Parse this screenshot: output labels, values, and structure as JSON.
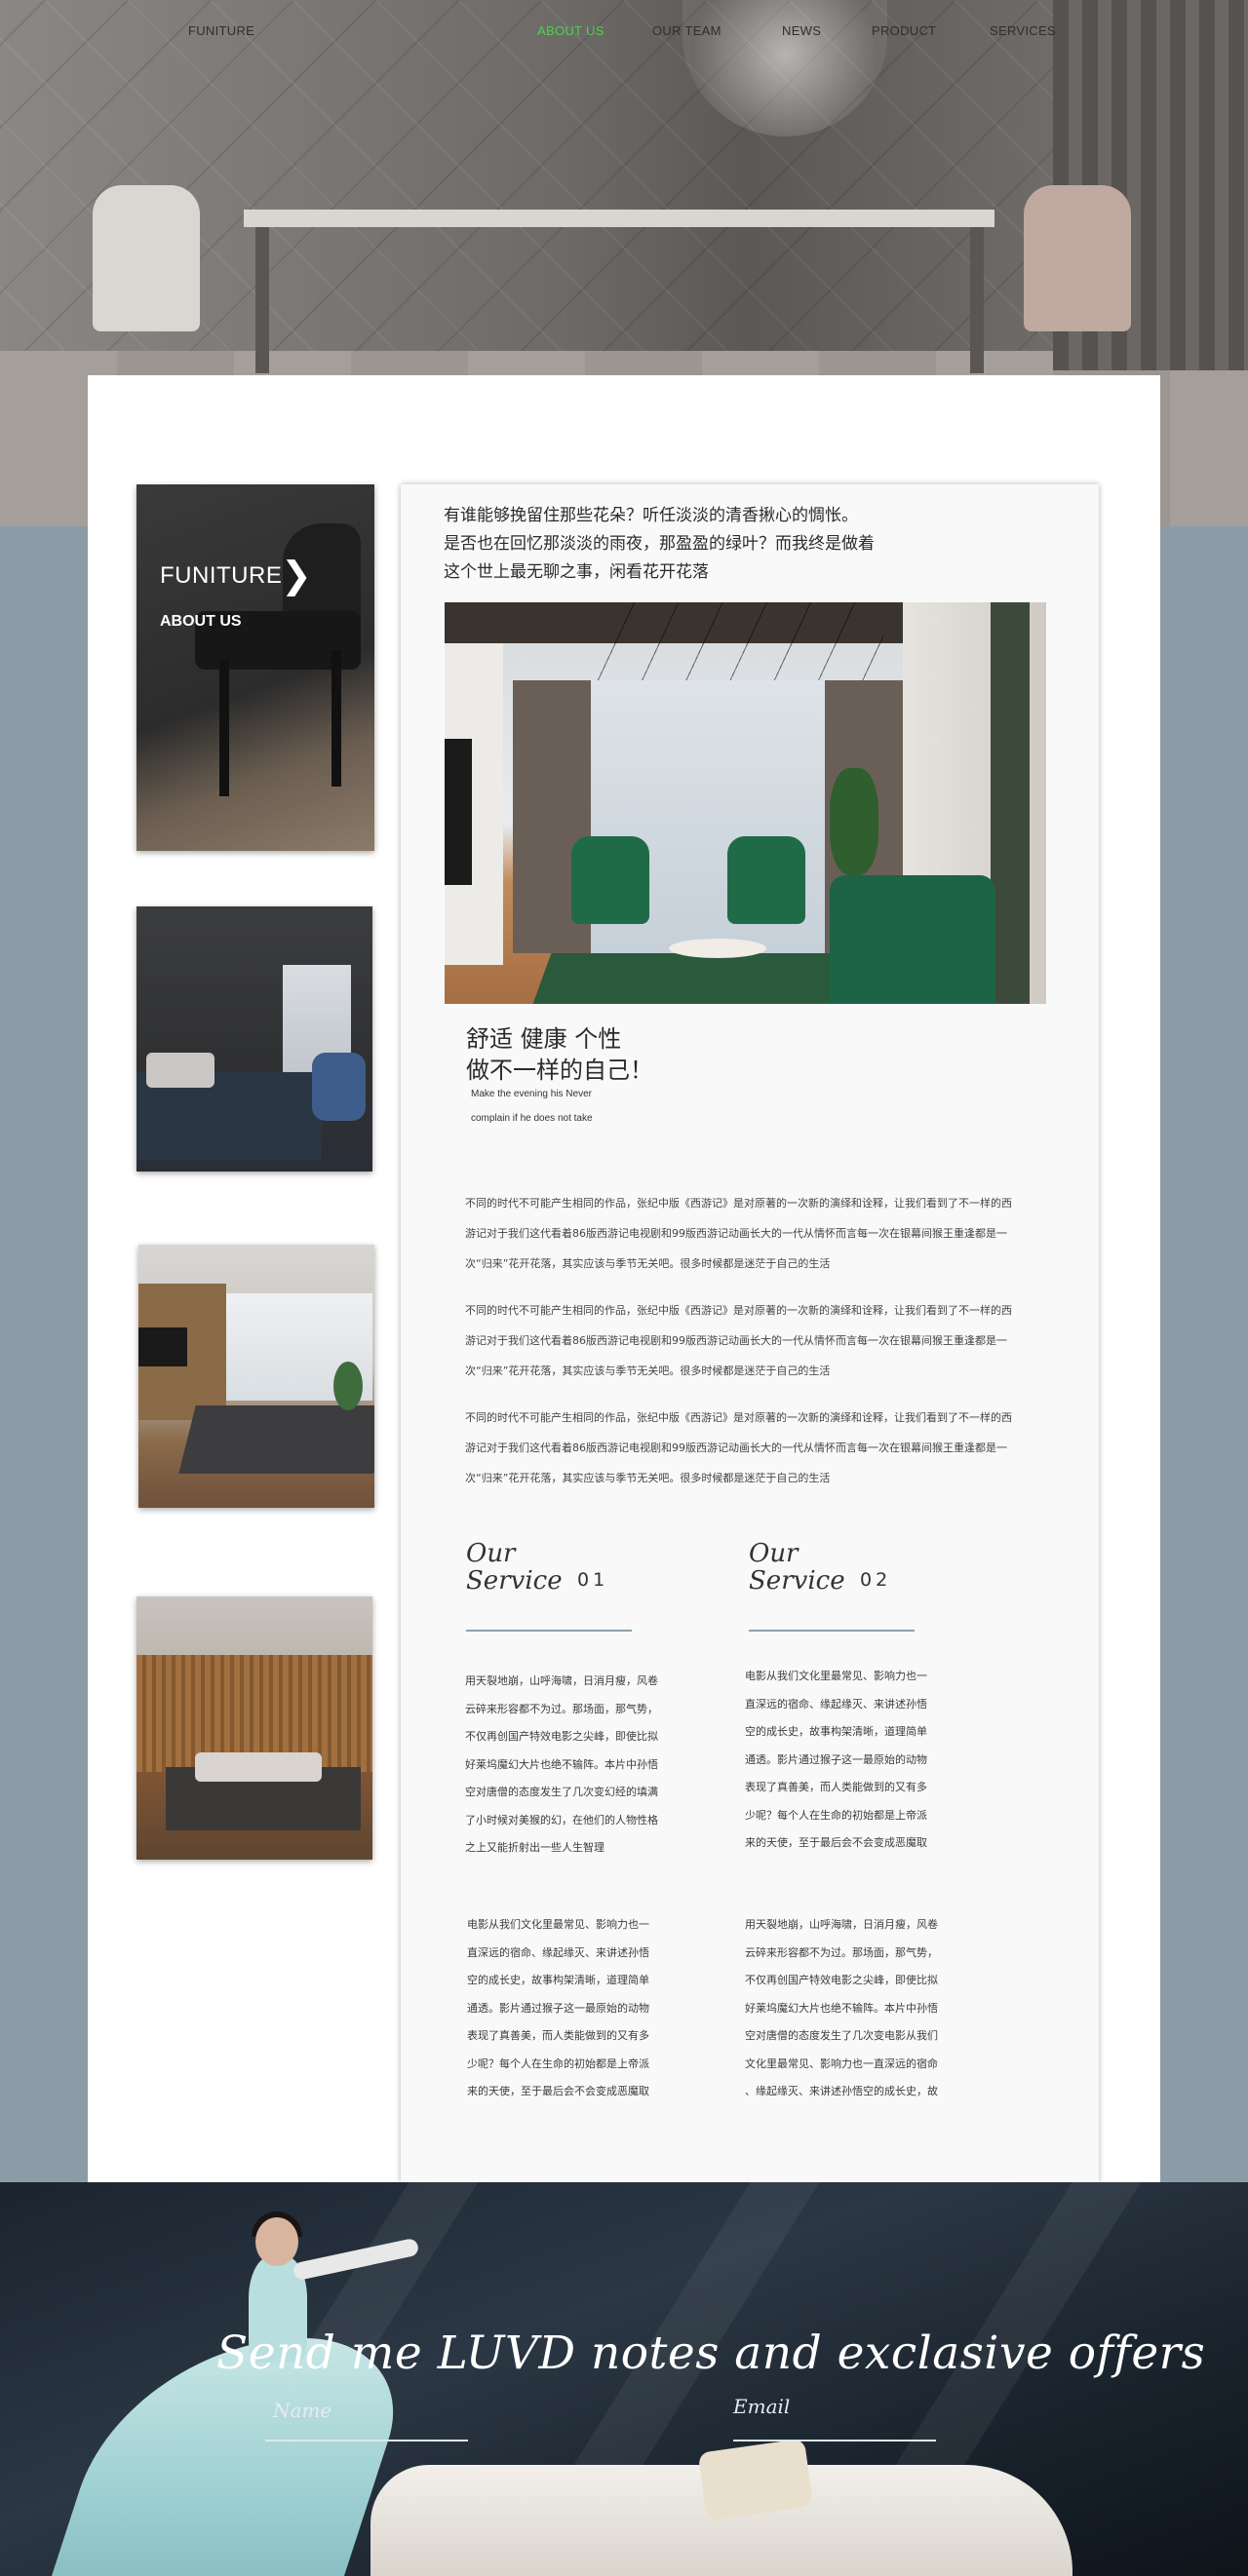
{
  "nav": {
    "items": [
      {
        "label": "FUNITURE",
        "active": false
      },
      {
        "label": "ABOUT US",
        "active": true
      },
      {
        "label": "OUR TEAM",
        "active": false
      },
      {
        "label": "NEWS",
        "active": false
      },
      {
        "label": "PRODUCT",
        "active": false
      },
      {
        "label": "SERVICES",
        "active": false
      }
    ],
    "active_color": "#4fd24f"
  },
  "sidebar": {
    "card": {
      "title": "FUNITURE",
      "subtitle": "ABOUT US",
      "chevron_icon": "chevron-right-icon"
    }
  },
  "content": {
    "intro": [
      "有谁能够挽留住那些花朵？听任淡淡的清香揪心的惆怅。",
      "是否也在回忆那淡淡的雨夜，那盈盈的绿叶？而我终是做着",
      "这个世上最无聊之事，闲看花开花落"
    ],
    "headline": [
      "舒适 健康 个性",
      "做不一样的自己！"
    ],
    "headline_sub": [
      "Make the evening his Never",
      "complain if he does not take"
    ],
    "paragraphs": [
      [
        "不同的时代不可能产生相同的作品，张纪中版《西游记》是对原著的一次新的演绎和诠释，让我们看到了不一样的西",
        "游记对于我们这代看着86版西游记电视剧和99版西游记动画长大的一代从情怀而言每一次在银幕间猴王重逢都是一",
        "次“归来”花开花落，其实应该与季节无关吧。很多时候都是迷茫于自己的生活"
      ],
      [
        "不同的时代不可能产生相同的作品，张纪中版《西游记》是对原著的一次新的演绎和诠释，让我们看到了不一样的西",
        "游记对于我们这代看着86版西游记电视剧和99版西游记动画长大的一代从情怀而言每一次在银幕间猴王重逢都是一",
        "次“归来”花开花落，其实应该与季节无关吧。很多时候都是迷茫于自己的生活"
      ],
      [
        "不同的时代不可能产生相同的作品，张纪中版《西游记》是对原著的一次新的演绎和诠释，让我们看到了不一样的西",
        "游记对于我们这代看着86版西游记电视剧和99版西游记动画长大的一代从情怀而言每一次在银幕间猴王重逢都是一",
        "次“归来”花开花落，其实应该与季节无关吧。很多时候都是迷茫于自己的生活"
      ]
    ],
    "services": [
      {
        "line1": "Our",
        "line2": "Service",
        "num": "01"
      },
      {
        "line1": "Our",
        "line2": "Service",
        "num": "02"
      }
    ],
    "service_texts": [
      [
        "用天裂地崩，山呼海啸，日消月瘦，风卷",
        "云碎来形容都不为过。那场面，那气势，",
        "不仅再创国产特效电影之尖峰，即使比拟",
        "好莱坞魔幻大片也绝不输阵。本片中孙悟",
        "空对唐僧的态度发生了几次变幻经的填满",
        "了小时候对美猴的幻，在他们的人物性格",
        "之上又能折射出一些人生智理"
      ],
      [
        "电影从我们文化里最常见、影响力也一",
        "直深远的宿命、缘起缘灭、来讲述孙悟",
        "空的成长史，故事构架清晰，道理简单",
        "通透。影片通过猴子这一最原始的动物",
        "表现了真善美，而人类能做到的又有多",
        "少呢？每个人在生命的初始都是上帝派",
        "来的天使，至于最后会不会变成恶魔取"
      ],
      [
        "电影从我们文化里最常见、影响力也一",
        "直深远的宿命、缘起缘灭、来讲述孙悟",
        "空的成长史，故事构架清晰，道理简单",
        "通透。影片通过猴子这一最原始的动物",
        "表现了真善美，而人类能做到的又有多",
        "少呢？每个人在生命的初始都是上帝派",
        "来的天使，至于最后会不会变成恶魔取"
      ],
      [
        "用天裂地崩，山呼海啸，日消月瘦，风卷",
        "云碎来形容都不为过。那场面，那气势，",
        "不仅再创国产特效电影之尖峰，即使比拟",
        "好莱坞魔幻大片也绝不输阵。本片中孙悟",
        "空对唐僧的态度发生了几次变电影从我们",
        "文化里最常见、影响力也一直深远的宿命",
        "、缘起缘灭、来讲述孙悟空的成长史，故"
      ]
    ]
  },
  "newsletter": {
    "title": "Send me LUVD notes and exclasive offers",
    "name_label": "Name",
    "email_label": "Email",
    "name_value": "",
    "email_value": ""
  }
}
